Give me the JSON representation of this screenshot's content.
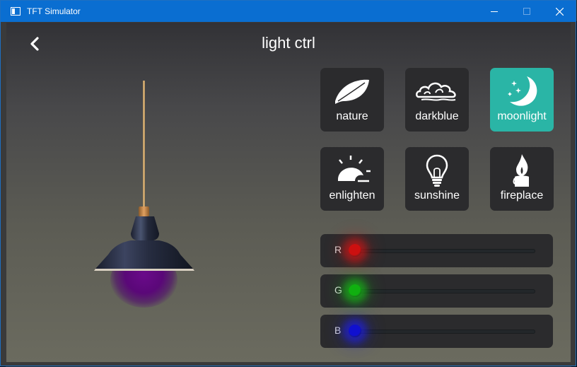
{
  "window": {
    "title": "TFT Simulator"
  },
  "app": {
    "title": "light ctrl"
  },
  "scenes": [
    {
      "id": "nature",
      "label": "nature",
      "icon": "leaf-icon",
      "active": false
    },
    {
      "id": "darkblue",
      "label": "darkblue",
      "icon": "cloud-icon",
      "active": false
    },
    {
      "id": "moonlight",
      "label": "moonlight",
      "icon": "moon-icon",
      "active": true
    },
    {
      "id": "enlighten",
      "label": "enlighten",
      "icon": "sunrise-icon",
      "active": false
    },
    {
      "id": "sunshine",
      "label": "sunshine",
      "icon": "lightbulb-icon",
      "active": false
    },
    {
      "id": "fireplace",
      "label": "fireplace",
      "icon": "candle-icon",
      "active": false
    }
  ],
  "sliders": [
    {
      "label": "R",
      "value": 0.0,
      "color": "#cc1010",
      "glow": "rgba(220,20,20,0.55)"
    },
    {
      "label": "G",
      "value": 0.0,
      "color": "#10b010",
      "glow": "rgba(20,200,20,0.55)"
    },
    {
      "label": "B",
      "value": 0.0,
      "color": "#1010d0",
      "glow": "rgba(30,30,230,0.6)"
    }
  ],
  "colors": {
    "accent": "#2ab5a6",
    "panel": "#2b2b2d",
    "titlebar": "#0a6ed1",
    "lamp_light": "#6a0a8a"
  }
}
